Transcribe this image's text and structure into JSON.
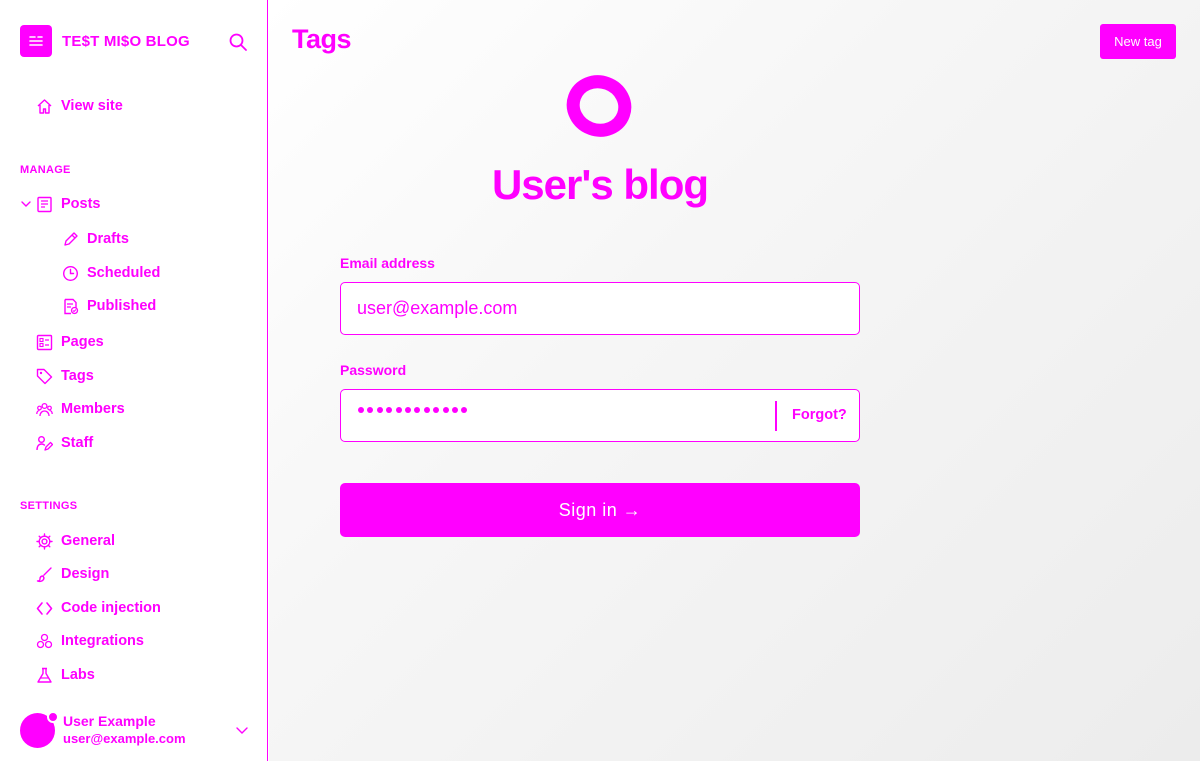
{
  "brand": {
    "title": "TE$T MI$O BLOG"
  },
  "sidebar": {
    "view_site": "View site",
    "manage_title": "MANAGE",
    "posts": "Posts",
    "drafts": "Drafts",
    "scheduled": "Scheduled",
    "published": "Published",
    "pages": "Pages",
    "tags": "Tags",
    "members": "Members",
    "staff": "Staff",
    "settings_title": "SETTINGS",
    "general": "General",
    "design": "Design",
    "code_injection": "Code injection",
    "integrations": "Integrations",
    "labs": "Labs"
  },
  "user": {
    "name": "User Example",
    "email": "user@example.com"
  },
  "main": {
    "page_title": "Tags",
    "new_tag_label": "New tag"
  },
  "login": {
    "blog_title": "User's blog",
    "email_label": "Email address",
    "email_value": "user@example.com",
    "password_label": "Password",
    "password_dots": 12,
    "forgot_label": "Forgot?",
    "signin_label": "Sign in →"
  },
  "colors": {
    "accent": "#ff00ff",
    "background": "#ffffff"
  },
  "icons": [
    "sidebar-toggle-icon",
    "search-icon",
    "home-icon",
    "chevron-down-icon",
    "posts-icon",
    "pencil-icon",
    "clock-icon",
    "published-icon",
    "pages-icon",
    "tag-icon",
    "members-icon",
    "staff-icon",
    "gear-icon",
    "brush-icon",
    "code-icon",
    "integrations-icon",
    "flask-icon",
    "logo-ring-icon"
  ]
}
